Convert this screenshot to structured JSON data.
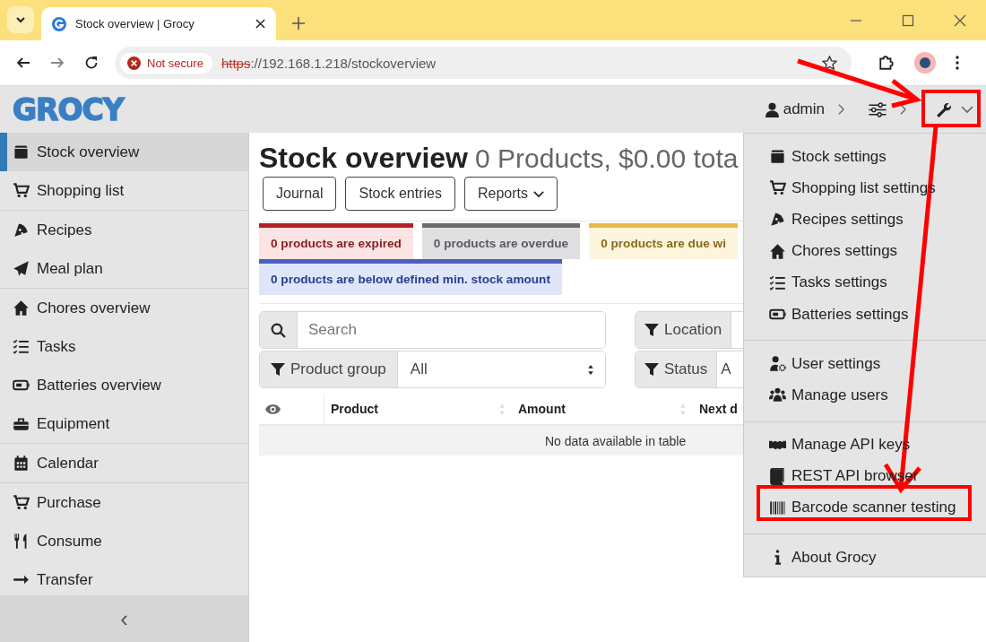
{
  "browser": {
    "tab_title": "Stock overview | Grocy",
    "security": "Not secure",
    "url_scheme": "https",
    "url_rest": "://192.168.1.218/stockoverview"
  },
  "header": {
    "logo": "GROCY",
    "user": "admin"
  },
  "sidebar": {
    "groups": [
      [
        {
          "label": "Stock overview",
          "selected": true
        },
        {
          "label": "Shopping list",
          "selected": false
        }
      ],
      [
        {
          "label": "Recipes",
          "selected": false
        },
        {
          "label": "Meal plan",
          "selected": false
        }
      ],
      [
        {
          "label": "Chores overview",
          "selected": false
        },
        {
          "label": "Tasks",
          "selected": false
        },
        {
          "label": "Batteries overview",
          "selected": false
        },
        {
          "label": "Equipment",
          "selected": false
        }
      ],
      [
        {
          "label": "Calendar",
          "selected": false
        }
      ],
      [
        {
          "label": "Purchase",
          "selected": false
        },
        {
          "label": "Consume",
          "selected": false
        },
        {
          "label": "Transfer",
          "selected": false
        }
      ]
    ],
    "collapse": "‹"
  },
  "main": {
    "title": "Stock overview",
    "subtitle": "0 Products, $0.00 tota",
    "buttons": [
      {
        "label": "Journal",
        "kind": "plain"
      },
      {
        "label": "Stock entries",
        "kind": "plain"
      },
      {
        "label": "Reports",
        "kind": "dropdown"
      }
    ],
    "alerts": [
      {
        "text": "0 products are expired",
        "kind": "danger",
        "color": "#b52025"
      },
      {
        "text": "0 products are overdue",
        "kind": "secondary",
        "color": "#6c6c6c"
      },
      {
        "text": "0 products are due wi",
        "kind": "warning",
        "color": "#e9b949"
      },
      {
        "text": "0 products are below defined min. stock amount",
        "kind": "info",
        "color": "#4a5fc1"
      }
    ],
    "search": {
      "placeholder": "Search"
    },
    "filters": [
      {
        "label": "Product group",
        "value": "All"
      },
      {
        "label": "Location"
      },
      {
        "label": "Status",
        "value": "A"
      }
    ],
    "table": {
      "columns": [
        "Product",
        "Amount",
        "Next d"
      ],
      "empty": "No data available in table"
    }
  },
  "settings_menu": {
    "groups": [
      [
        "Stock settings",
        "Shopping list settings",
        "Recipes settings",
        "Chores settings",
        "Tasks settings",
        "Batteries settings"
      ],
      [
        "User settings",
        "Manage users"
      ],
      [
        "Manage API keys",
        "REST API browser",
        "Barcode scanner testing"
      ],
      [
        "About Grocy"
      ]
    ]
  }
}
